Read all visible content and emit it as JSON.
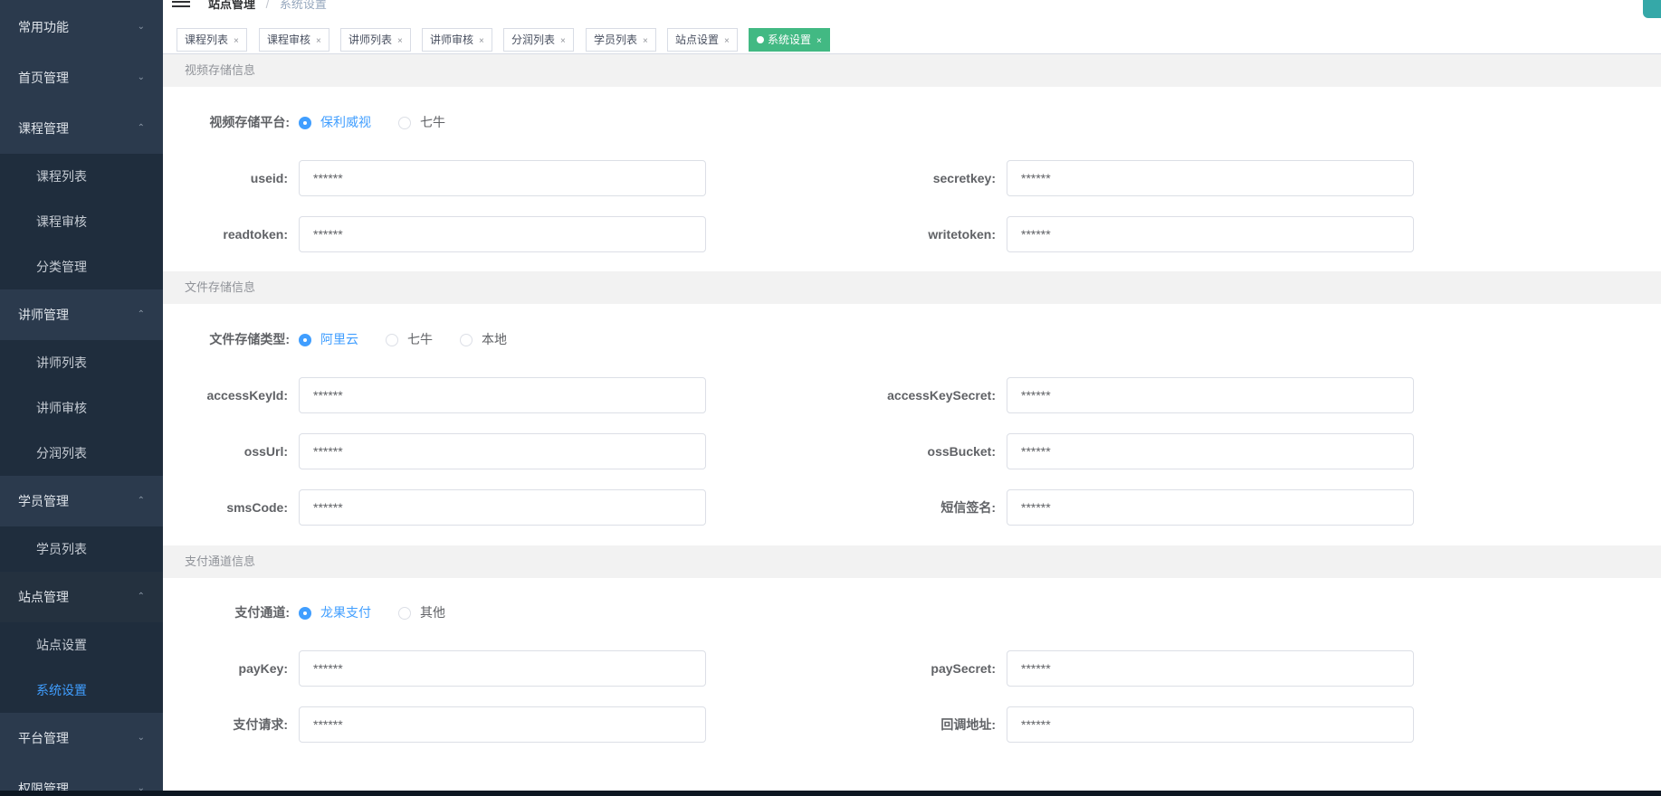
{
  "sidebar": {
    "groups": [
      {
        "label": "常用功能",
        "chevron": "⌄"
      },
      {
        "label": "首页管理",
        "chevron": "⌄"
      },
      {
        "label": "课程管理",
        "chevron": "⌃"
      },
      {
        "label": "讲师管理",
        "chevron": "⌃"
      },
      {
        "label": "学员管理",
        "chevron": "⌃"
      },
      {
        "label": "站点管理",
        "chevron": "⌃"
      },
      {
        "label": "平台管理",
        "chevron": "⌄"
      },
      {
        "label": "权限管理",
        "chevron": "⌄"
      }
    ],
    "course_items": [
      "课程列表",
      "课程审核",
      "分类管理"
    ],
    "teacher_items": [
      "讲师列表",
      "讲师审核",
      "分润列表"
    ],
    "student_items": [
      "学员列表"
    ],
    "site_items": [
      "站点设置",
      "系统设置"
    ],
    "active_color": "#409eff"
  },
  "header": {
    "breadcrumb_root": "站点管理",
    "breadcrumb_sep": "/",
    "breadcrumb_current": "系统设置"
  },
  "tags": [
    {
      "label": "课程列表",
      "close": "×"
    },
    {
      "label": "课程审核",
      "close": "×"
    },
    {
      "label": "讲师列表",
      "close": "×"
    },
    {
      "label": "讲师审核",
      "close": "×"
    },
    {
      "label": "分润列表",
      "close": "×"
    },
    {
      "label": "学员列表",
      "close": "×"
    },
    {
      "label": "站点设置",
      "close": "×"
    },
    {
      "label": "系统设置",
      "close": "×",
      "active": true
    }
  ],
  "tag_active_color": "#42b983",
  "video": {
    "section_title": "视频存储信息",
    "platform_label": "视频存储平台:",
    "options": [
      "保利威视",
      "七牛"
    ],
    "selected": "保利威视",
    "fields": {
      "useid": {
        "label": "useid:",
        "value": "******"
      },
      "secretkey": {
        "label": "secretkey:",
        "value": "******"
      },
      "readtoken": {
        "label": "readtoken:",
        "value": "******"
      },
      "writetoken": {
        "label": "writetoken:",
        "value": "******"
      }
    }
  },
  "file": {
    "section_title": "文件存储信息",
    "type_label": "文件存储类型:",
    "options": [
      "阿里云",
      "七牛",
      "本地"
    ],
    "selected": "阿里云",
    "fields": {
      "accessKeyId": {
        "label": "accessKeyId:",
        "value": "******"
      },
      "accessKeySecret": {
        "label": "accessKeySecret:",
        "value": "******"
      },
      "ossUrl": {
        "label": "ossUrl:",
        "value": "******"
      },
      "ossBucket": {
        "label": "ossBucket:",
        "value": "******"
      },
      "smsCode": {
        "label": "smsCode:",
        "value": "******"
      },
      "smsSign": {
        "label": "短信签名:",
        "value": "******"
      }
    }
  },
  "pay": {
    "section_title": "支付通道信息",
    "channel_label": "支付通道:",
    "options": [
      "龙果支付",
      "其他"
    ],
    "selected": "龙果支付",
    "fields": {
      "payKey": {
        "label": "payKey:",
        "value": "******"
      },
      "paySecret": {
        "label": "paySecret:",
        "value": "******"
      },
      "payRequest": {
        "label": "支付请求:",
        "value": "******"
      },
      "callback": {
        "label": "回调地址:",
        "value": "******"
      }
    }
  }
}
